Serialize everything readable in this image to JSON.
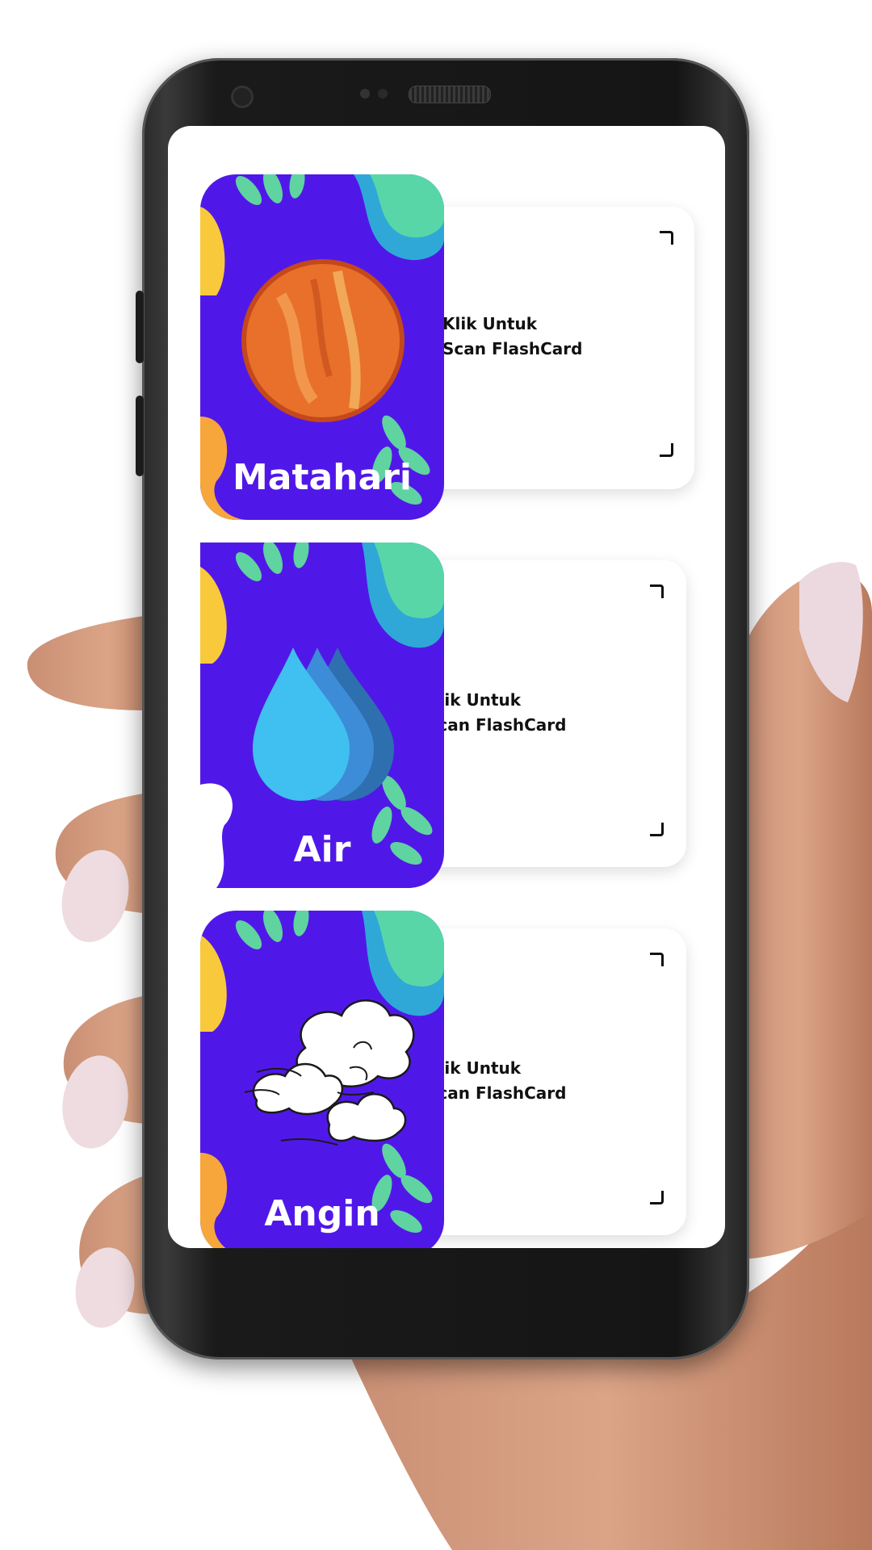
{
  "cards": [
    {
      "title": "Matahari",
      "image": "sun-planet-icon",
      "scan_line1": "Klik Untuk",
      "scan_line2": "Scan FlashCard"
    },
    {
      "title": "Air",
      "image": "water-drops-icon",
      "scan_line1": "Klik Untuk",
      "scan_line2": "Scan FlashCard"
    },
    {
      "title": "Angin",
      "image": "wind-clouds-icon",
      "scan_line1": "Klik Untuk",
      "scan_line2": "Scan FlashCard"
    }
  ],
  "colors": {
    "card_background": "#5018e8",
    "leaf": "#5fd3a0",
    "accent_orange": "#f7a63b",
    "water": "#3fc0f0",
    "sun": "#e8702a"
  }
}
